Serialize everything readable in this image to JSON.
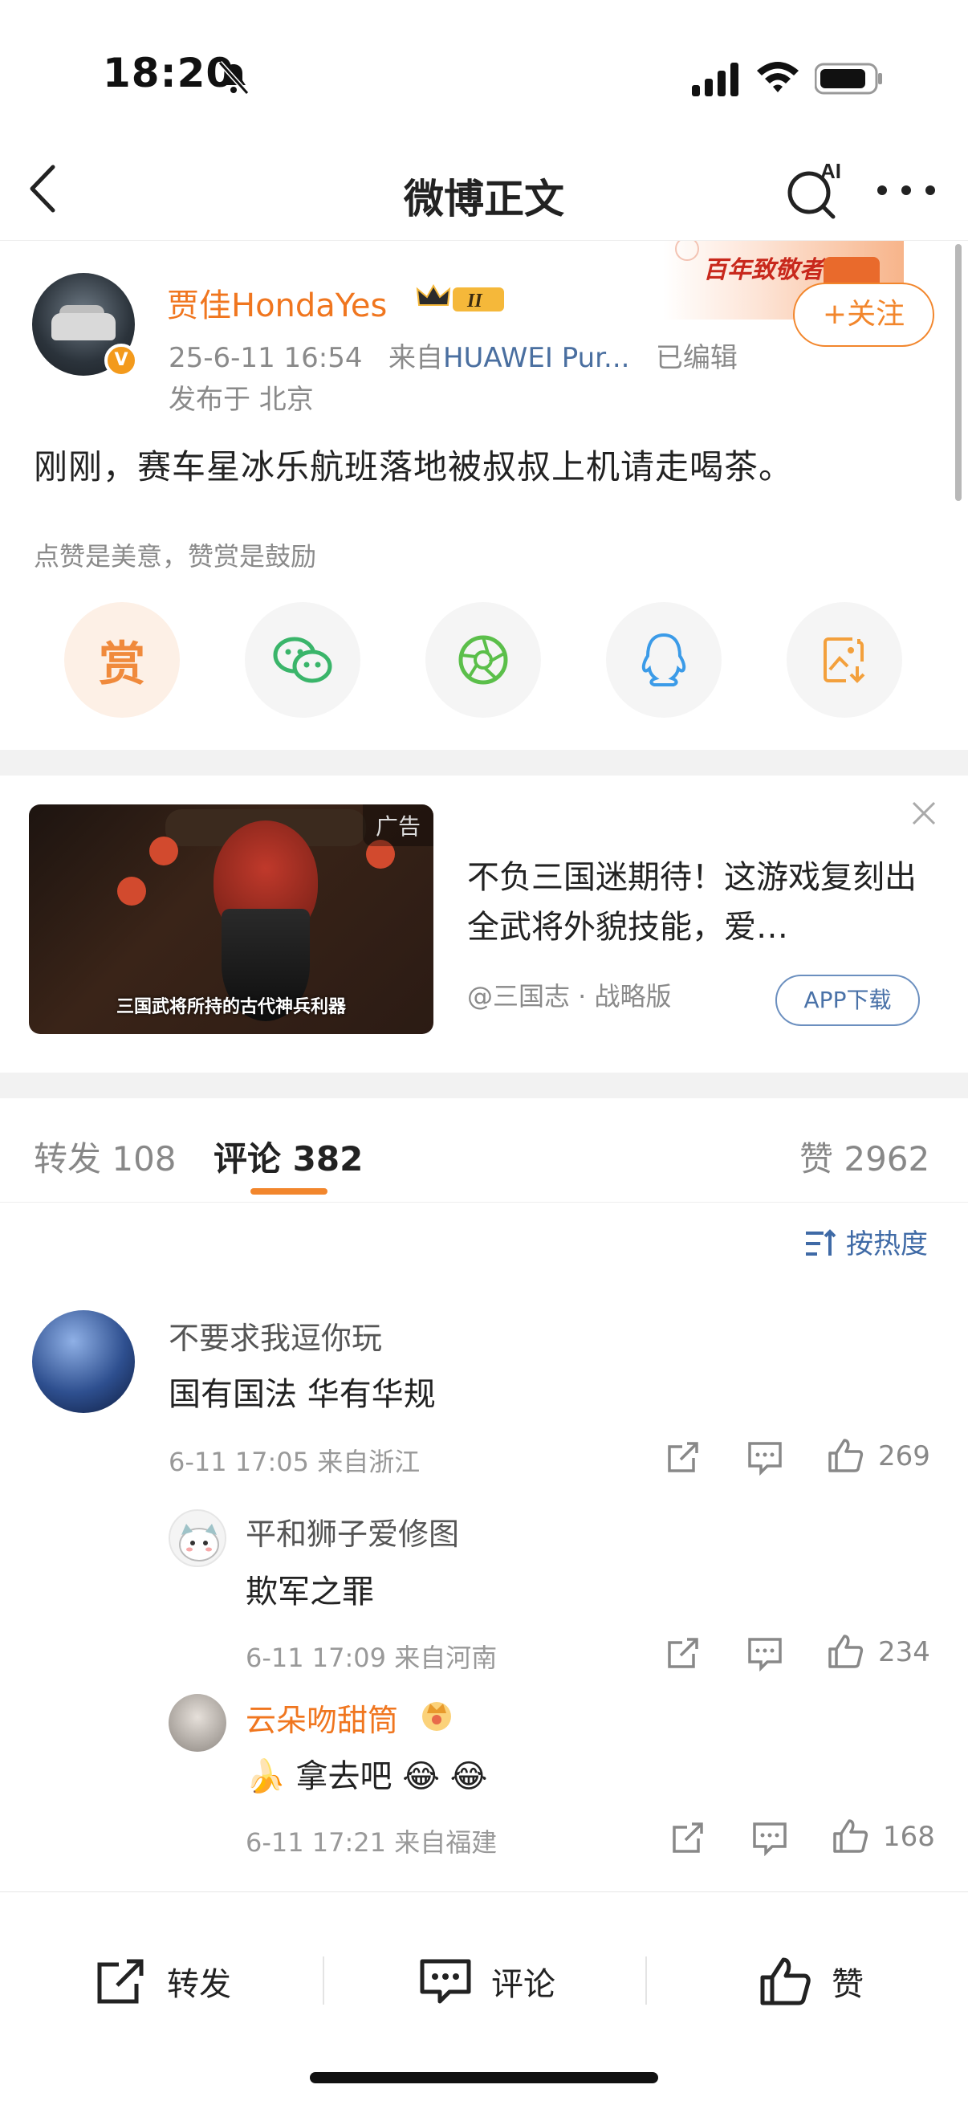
{
  "status": {
    "time": "18:20"
  },
  "nav": {
    "title": "微博正文"
  },
  "post": {
    "author": "贾佳HondaYes",
    "vip_level": "II",
    "verified_mark": "V",
    "datetime": "25-6-11 16:54",
    "source_prefix": "来自",
    "source": "HUAWEI Pur...",
    "edited": "已编辑",
    "location": "发布于 北京",
    "follow_label": "+关注",
    "banner_text": "百年致敬者",
    "text": "刚刚，赛车星冰乐航班落地被叔叔上机请走喝茶。",
    "encourage": "点赞是美意，赞赏是鼓励",
    "share": [
      {
        "name": "reward",
        "label": "赏",
        "icon": "reward-icon",
        "color": "#f08a3c"
      },
      {
        "name": "wechat",
        "icon": "wechat-icon",
        "color": "#3ab56a"
      },
      {
        "name": "moments",
        "icon": "moments-icon",
        "color": "#5bbf4a"
      },
      {
        "name": "qq",
        "icon": "qq-icon",
        "color": "#3b9be8"
      },
      {
        "name": "save-image",
        "icon": "save-image-icon",
        "color": "#f3a03c"
      }
    ]
  },
  "ad": {
    "tag": "广告",
    "caption": "三国武将所持的古代神兵利器",
    "title": "不负三国迷期待！这游戏复刻出全武将外貌技能，爱…",
    "source": "@三国志 · 战略版",
    "button": "APP下载"
  },
  "tabs": [
    {
      "label": "转发 108"
    },
    {
      "label": "评论 382",
      "active": true
    },
    {
      "label": "赞 2962"
    }
  ],
  "sort_label": "按热度",
  "comments": [
    {
      "name": "不要求我逗你玩",
      "text": "国有国法 华有华规",
      "meta": "6-11 17:05  来自浙江",
      "likes": "269"
    },
    {
      "name": "平和狮子爱修图",
      "text": "欺军之罪",
      "meta": "6-11 17:09  来自河南",
      "likes": "234"
    },
    {
      "name": "云朵吻甜筒",
      "text": "🍌 拿去吧 😂 😂",
      "meta": "6-11 17:21  来自福建",
      "likes": "168"
    }
  ],
  "bottom_bar": {
    "repost": "转发",
    "comment": "评论",
    "like": "赞"
  },
  "colors": {
    "accent": "#f2862c",
    "link": "#3f6aa6",
    "username": "#f0761f"
  }
}
